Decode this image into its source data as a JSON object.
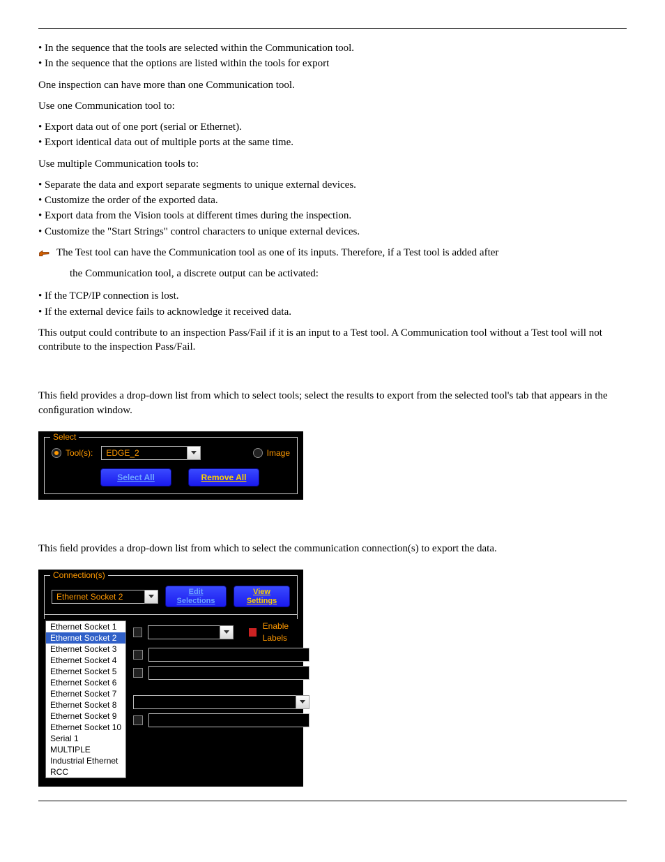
{
  "body": {
    "bullets_top": [
      "• In the sequence that the tools are selected within the Communication tool.",
      "• In the sequence that the options are listed within the tools for export"
    ],
    "p1": "One inspection can have more than one Communication tool.",
    "p2": "Use one Communication tool to:",
    "bullets_onecomm": [
      "• Export data out of one port (serial or Ethernet).",
      "• Export identical data out of multiple ports at the same time."
    ],
    "p3": "Use multiple Communication tools to:",
    "bullets_multicomm": [
      "• Separate the data and export separate segments to unique external devices.",
      "• Customize the order of the exported data.",
      "• Export data from the Vision tools at different times during the inspection.",
      "• Customize the \"Start Strings\" control characters to unique external devices."
    ],
    "note": "The Test tool can have the Communication tool as one of its inputs. Therefore, if a Test tool is added after",
    "note_tail": "the Communication tool, a discrete output can be activated:",
    "bullets_testtool": [
      "• If the TCP/IP connection is lost.",
      "• If the external device fails to acknowledge it received data."
    ],
    "p4": "This output could contribute to an inspection Pass/Fail if it is an input to a Test tool. A Communication tool without a Test tool will not contribute to the inspection Pass/Fail.",
    "select_intro": "This ﬁeld provides a drop-down list from which to select tools; select the results to export from the selected tool's tab that appears in the conﬁguration window.",
    "conn_intro": "This ﬁeld provides a drop-down list from which to select the communication connection(s) to export the data."
  },
  "select_panel": {
    "legend": "Select",
    "tools_label": "Tool(s):",
    "tools_value": "EDGE_2",
    "image_label": "Image",
    "btn_select_all": "Select All",
    "btn_remove_all": "Remove All"
  },
  "conn_panel": {
    "legend": "Connection(s)",
    "combo_value": "Ethernet Socket 2",
    "btn_edit": "Edit Selections",
    "btn_view": "View Settings",
    "enable_labels": "Enable Labels",
    "options": [
      "Ethernet Socket 1",
      "Ethernet Socket 2",
      "Ethernet Socket 3",
      "Ethernet Socket 4",
      "Ethernet Socket 5",
      "Ethernet Socket 6",
      "Ethernet Socket 7",
      "Ethernet Socket 8",
      "Ethernet Socket 9",
      "Ethernet Socket 10",
      "Serial 1",
      "MULTIPLE",
      "Industrial Ethernet",
      "RCC"
    ]
  }
}
